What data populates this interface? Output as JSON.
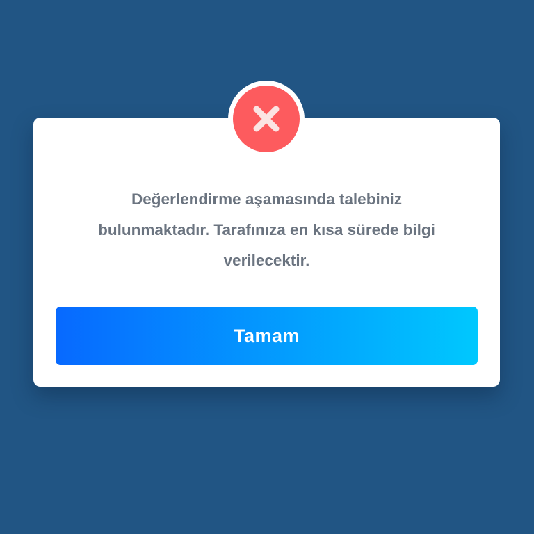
{
  "colors": {
    "background": "#215584",
    "dialog_background": "#ffffff",
    "error_badge": "#fd5b5e",
    "error_cross": "#fbe4e3",
    "message_text": "#6b7480",
    "button_gradient_start": "#0769ff",
    "button_gradient_end": "#00c8fe",
    "button_text": "#ffffff"
  },
  "dialog": {
    "status_icon": "close-icon",
    "message": "Değerlendirme aşamasında talebiniz\nbulunmaktadır. Tarafınıza en kısa sürede bilgi\nverilecektir.",
    "ok_button_label": "Tamam"
  }
}
